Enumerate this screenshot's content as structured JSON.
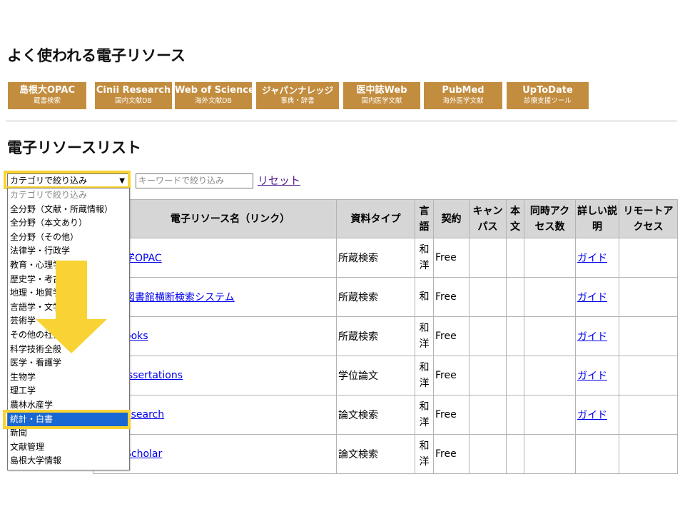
{
  "headings": {
    "favorites": "よく使われる電子リソース",
    "list": "電子リソースリスト"
  },
  "tiles": [
    {
      "main": "島根大OPAC",
      "sub": "蔵書検索"
    },
    {
      "main": "Cinii Research",
      "sub": "国内文献DB"
    },
    {
      "main": "Web of Science",
      "sub": "海外文献DB"
    },
    {
      "main": "ジャパンナレッジ",
      "sub": "事典・辞書"
    },
    {
      "main": "医中誌Web",
      "sub": "国内医学文献"
    },
    {
      "main": "PubMed",
      "sub": "海外医学文献"
    },
    {
      "main": "UpToDate",
      "sub": "診療支援ツール"
    }
  ],
  "filter": {
    "category_value": "カテゴリで絞り込み",
    "keyword_placeholder": "キーワードで絞り込み",
    "reset_label": "リセット"
  },
  "dropdown_options": [
    "カテゴリで絞り込み",
    "全分野（文献・所蔵情報）",
    "全分野（本文あり）",
    "全分野（その他）",
    "法律学・行政学",
    "教育・心理学",
    "歴史学・考古学",
    "地理・地質学",
    "言語学・文学",
    "芸術学",
    "その他の社会科学",
    "科学技術全般",
    "医学・看護学",
    "生物学",
    "理工学",
    "農林水産学",
    "統計・白書",
    "新聞",
    "文献管理",
    "島根大学情報"
  ],
  "dropdown_selected_index": 16,
  "table": {
    "headers": [
      "電子リソース名（リンク）",
      "資料タイプ",
      "言語",
      "契約",
      "キャンパス",
      "本文",
      "同時アクセス数",
      "詳しい説明",
      "リモートアクセス"
    ],
    "rows": [
      {
        "name": "学OPAC",
        "type": "所蔵検索",
        "lang": "和洋",
        "contract": "Free",
        "detail": "ガイド"
      },
      {
        "name": "図書館横断検索システム",
        "type": "所蔵検索",
        "lang": "和",
        "contract": "Free",
        "detail": "ガイド"
      },
      {
        "name": "ooks",
        "type": "所蔵検索",
        "lang": "和洋",
        "contract": "Free",
        "detail": "ガイド"
      },
      {
        "name": "issertations",
        "type": "学位論文",
        "lang": "和洋",
        "contract": "Free",
        "detail": "ガイド"
      },
      {
        "name": "esearch",
        "type": "論文検索",
        "lang": "和洋",
        "contract": "Free",
        "detail": "ガイド"
      },
      {
        "name": "Scholar",
        "type": "論文検索",
        "lang": "和洋",
        "contract": "Free",
        "detail": ""
      }
    ]
  },
  "colors": {
    "tile": "#c38d3f",
    "highlight": "#f9d333",
    "selected_option": "#1967d2",
    "arrow": "#f9d333"
  },
  "icons": {
    "select_chevron": "chevron-down-icon",
    "arrow": "down-arrow-icon"
  }
}
